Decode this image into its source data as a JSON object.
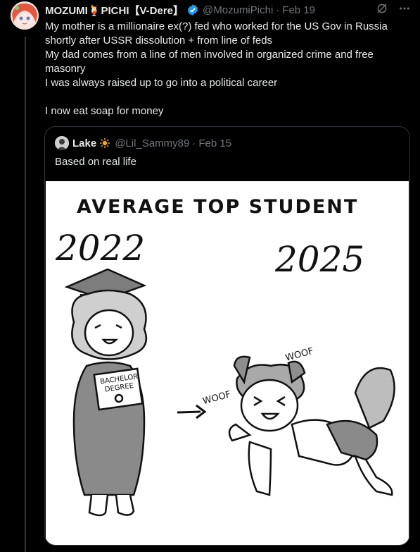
{
  "tweet": {
    "display_name": "MOZUMI🍹PICHI【V-Dere】",
    "handle": "@MozumiPichi",
    "separator": "·",
    "date": "Feb 19",
    "lines": [
      "My mother is a millionaire ex(?) fed who worked for the US Gov in Russia",
      "shortly after USSR dissolution + from line of feds",
      "My dad comes from a line of men involved in organized crime and free",
      "masonry",
      "I was always raised up to go into a political career",
      "",
      "I now eat soap for money"
    ]
  },
  "quote": {
    "display_name": "Lake",
    "handle": "@Lil_Sammy89",
    "separator": "·",
    "date": "Feb 15",
    "text": "Based on real life"
  },
  "comic": {
    "title": "AVERAGE TOP STUDENT",
    "year_left": "2022",
    "year_right": "2025",
    "diploma_line1": "BACHELOR",
    "diploma_line2": "DEGREE",
    "woof_left": "WOOF",
    "woof_right": "WOOF"
  },
  "colors": {
    "background": "#000000",
    "text_primary": "#e7e9ea",
    "text_secondary": "#71767b",
    "border": "#2f3336",
    "verified_blue": "#1d9bf0",
    "sun_orange": "#f5a623"
  },
  "icons": {
    "verified": "verified-badge-icon",
    "grok": "grok-icon",
    "more": "more-icon",
    "sun": "sun-icon"
  }
}
